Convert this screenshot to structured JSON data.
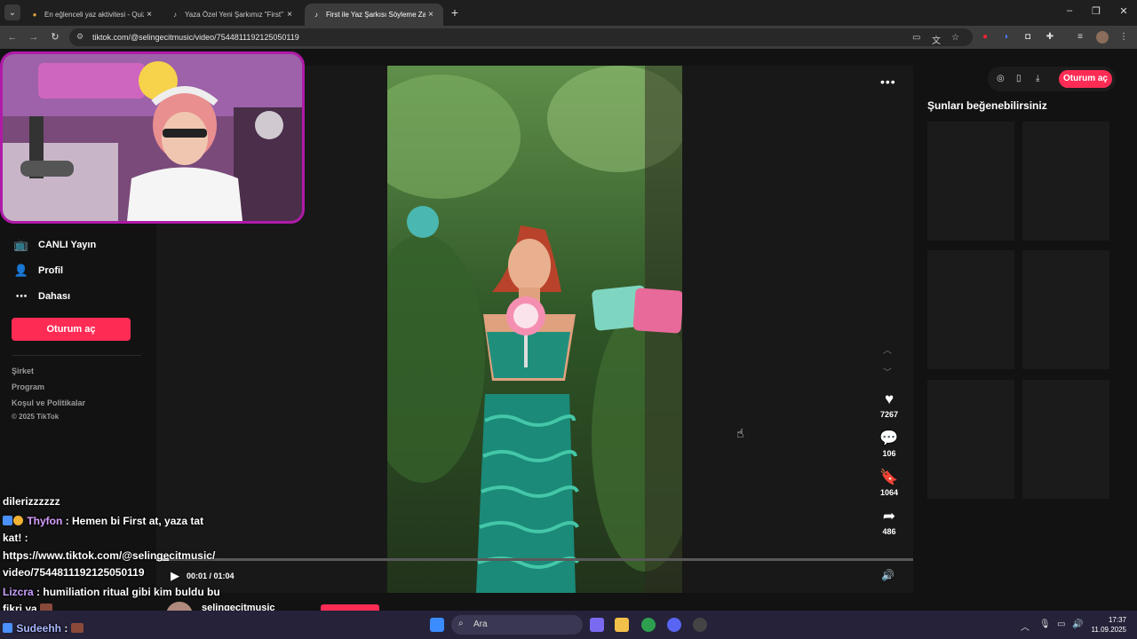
{
  "browser": {
    "tabs": [
      {
        "title": "En eğlenceli yaz aktivitesi - Quiz",
        "active": false
      },
      {
        "title": "Yaza Özel Yeni Şarkımız \"First\" | ",
        "active": false
      },
      {
        "title": "First ile Yaz Şarkısı Söyleme Zam",
        "active": true
      }
    ],
    "url": "tiktok.com/@selingecitmusic/video/7544811192125050119"
  },
  "sidebar": {
    "nav": [
      {
        "label": "CANLI Yayın",
        "icon": "live-icon"
      },
      {
        "label": "Profil",
        "icon": "profile-icon"
      },
      {
        "label": "Dahası",
        "icon": "more-icon"
      }
    ],
    "login_label": "Oturum aç",
    "footer": [
      "Şirket",
      "Program",
      "Koşul ve Politikalar",
      "© 2025 TikTok"
    ]
  },
  "video": {
    "actions": [
      {
        "icon": "heart-icon",
        "count": "7267"
      },
      {
        "icon": "comment-icon",
        "count": "106"
      },
      {
        "icon": "bookmark-icon",
        "count": "1064"
      },
      {
        "icon": "share-icon",
        "count": "486"
      }
    ],
    "time": "00:01 / 01:04",
    "progress": 0.016,
    "author": "selingecitmusic"
  },
  "header": {
    "login_label": "Oturum aç"
  },
  "suggestions": {
    "title": "Şunları beğenebilirsiniz"
  },
  "chat": [
    {
      "user": "",
      "text": "dilerizzzzzz"
    },
    {
      "user": "Thyfon",
      "text": ": Hemen bi First at, yaza tat"
    },
    {
      "user": "",
      "text": "kat! :"
    },
    {
      "user": "",
      "text": "https://www.tiktok.com/@selingecitmusic/"
    },
    {
      "user": "",
      "text": "video/7544811192125050119"
    },
    {
      "user": "Lizcra",
      "text": ": humiliation ritual gibi kim buldu bu"
    },
    {
      "user": "",
      "text": "fikri ya"
    },
    {
      "user": "Sudeehh",
      "text": ":"
    }
  ],
  "taskbar": {
    "search_label": "Ara",
    "time": "17:37",
    "date": "11.09.2025"
  },
  "colors": {
    "accent": "#fe2c55",
    "webcam_border": "#b01aa8",
    "taskbar": "#25223a"
  }
}
